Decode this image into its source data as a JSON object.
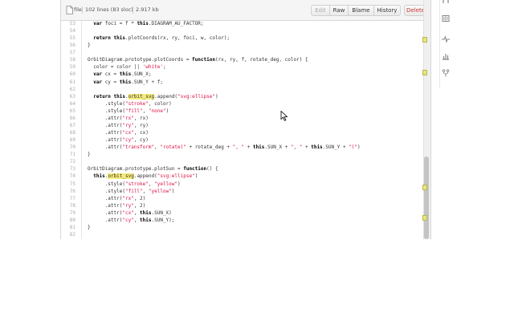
{
  "file_header": {
    "file_label": "file",
    "lines_info": "102 lines (83 sloc)",
    "size": "2.917 kb"
  },
  "buttons": {
    "edit": "Edit",
    "raw": "Raw",
    "blame": "Blame",
    "history": "History",
    "delete": "Delete"
  },
  "code_lines": [
    {
      "n": "53",
      "t": "  var foci = f * this.DIAGRAM_AU_FACTOR;"
    },
    {
      "n": "54",
      "t": ""
    },
    {
      "n": "55",
      "t": "  return this.plotCoords(rx, ry, foci, w, color);"
    },
    {
      "n": "56",
      "t": "}"
    },
    {
      "n": "57",
      "t": ""
    },
    {
      "n": "58",
      "t": "OrbitDiagram.prototype.plotCoords = function(rx, ry, f, rotate_deg, color) {"
    },
    {
      "n": "59",
      "t": "  color = color || 'white';"
    },
    {
      "n": "60",
      "t": "  var cx = this.SUN_X;"
    },
    {
      "n": "61",
      "t": "  var cy = this.SUN_Y + f;"
    },
    {
      "n": "62",
      "t": ""
    },
    {
      "n": "63",
      "t": "  return this.orbit_svg.append(\"svg:ellipse\")"
    },
    {
      "n": "64",
      "t": "      .style(\"stroke\", color)"
    },
    {
      "n": "65",
      "t": "      .style(\"fill\", \"none\")"
    },
    {
      "n": "66",
      "t": "      .attr(\"rx\", rx)"
    },
    {
      "n": "67",
      "t": "      .attr(\"ry\", ry)"
    },
    {
      "n": "68",
      "t": "      .attr(\"cx\", cx)"
    },
    {
      "n": "69",
      "t": "      .attr(\"cy\", cy)"
    },
    {
      "n": "70",
      "t": "      .attr(\"transform\", \"rotate(\" + rotate_deg + \", \" + this.SUN_X + \", \" + this.SUN_Y + \")\")"
    },
    {
      "n": "71",
      "t": "}"
    },
    {
      "n": "72",
      "t": ""
    },
    {
      "n": "73",
      "t": "OrbitDiagram.prototype.plotSun = function() {"
    },
    {
      "n": "74",
      "t": "  this.orbit_svg.append(\"svg:ellipse\")"
    },
    {
      "n": "75",
      "t": "      .style(\"stroke\", \"yellow\")"
    },
    {
      "n": "76",
      "t": "      .style(\"fill\", \"yellow\")"
    },
    {
      "n": "77",
      "t": "      .attr(\"rx\", 2)"
    },
    {
      "n": "78",
      "t": "      .attr(\"ry\", 2)"
    },
    {
      "n": "79",
      "t": "      .attr(\"cx\", this.SUN_X)"
    },
    {
      "n": "80",
      "t": "      .attr(\"cy\", this.SUN_Y);"
    },
    {
      "n": "81",
      "t": "}"
    },
    {
      "n": "82",
      "t": ""
    },
    {
      "n": "83",
      "t": "OrbitDiagram.prototype.plotEarth = function() {"
    }
  ],
  "keywords": [
    "var",
    "this",
    "return",
    "function"
  ],
  "highlight_word": "orbit_svg",
  "colors": {
    "header_bg": "#f5f5f5",
    "string": "#d14",
    "highlight": "#f5eb7a",
    "delete": "#c33"
  },
  "sidebar_icons": [
    "pull-request-icon",
    "wiki-icon",
    "pulse-icon",
    "graphs-icon",
    "network-icon"
  ]
}
